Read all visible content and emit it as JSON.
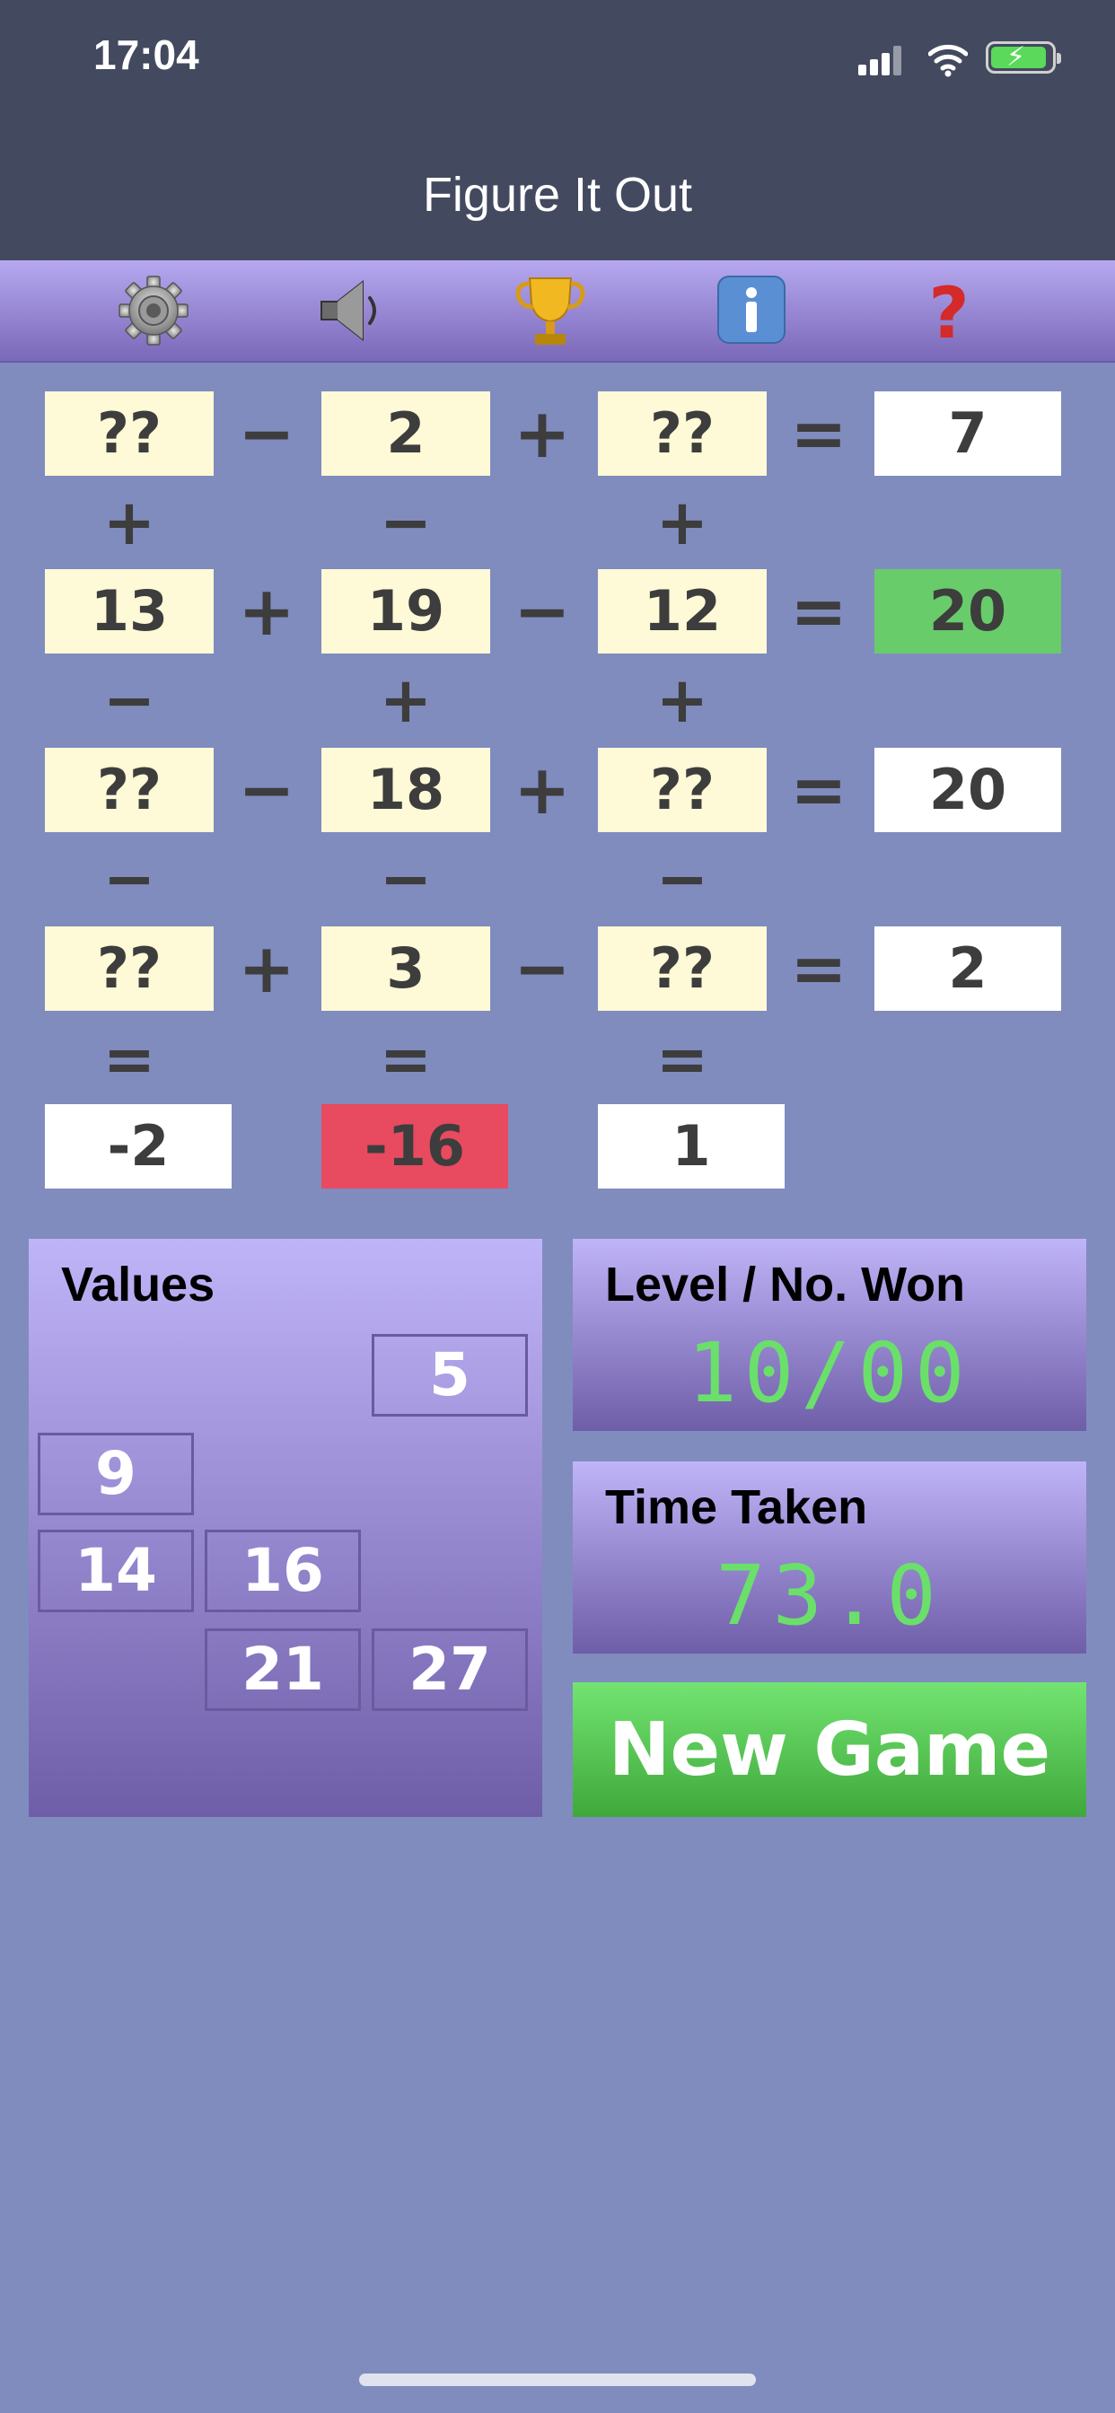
{
  "status": {
    "time": "17:04"
  },
  "header": {
    "title": "Figure It Out"
  },
  "grid": {
    "rows": [
      {
        "cells": [
          "??",
          "2",
          "??"
        ],
        "ops": [
          "−",
          "+"
        ],
        "eq": "=",
        "result": "7"
      },
      {
        "cells": [
          "13",
          "19",
          "12"
        ],
        "ops": [
          "+",
          "−"
        ],
        "eq": "=",
        "result": "20"
      },
      {
        "cells": [
          "??",
          "18",
          "??"
        ],
        "ops": [
          "−",
          "+"
        ],
        "eq": "=",
        "result": "20"
      },
      {
        "cells": [
          "??",
          "3",
          "??"
        ],
        "ops": [
          "+",
          "−"
        ],
        "eq": "=",
        "result": "2"
      }
    ],
    "vops": [
      [
        "+",
        "−",
        "+"
      ],
      [
        "−",
        "+",
        "+"
      ],
      [
        "−",
        "−",
        "−"
      ],
      [
        "=",
        "=",
        "="
      ]
    ],
    "column_results": [
      "-2",
      "-16",
      "1"
    ]
  },
  "values_panel": {
    "label": "Values",
    "values": [
      "5",
      "9",
      "14",
      "16",
      "21",
      "27"
    ]
  },
  "level_panel": {
    "label": "Level / No. Won",
    "value": "10/00"
  },
  "time_panel": {
    "label": "Time Taken",
    "value": "73.0"
  },
  "new_game_label": "New Game",
  "colors": {
    "correct": "#68cc6a",
    "wrong": "#e84a60",
    "digital": "#6ae06a",
    "cell": "#fef9d6"
  }
}
